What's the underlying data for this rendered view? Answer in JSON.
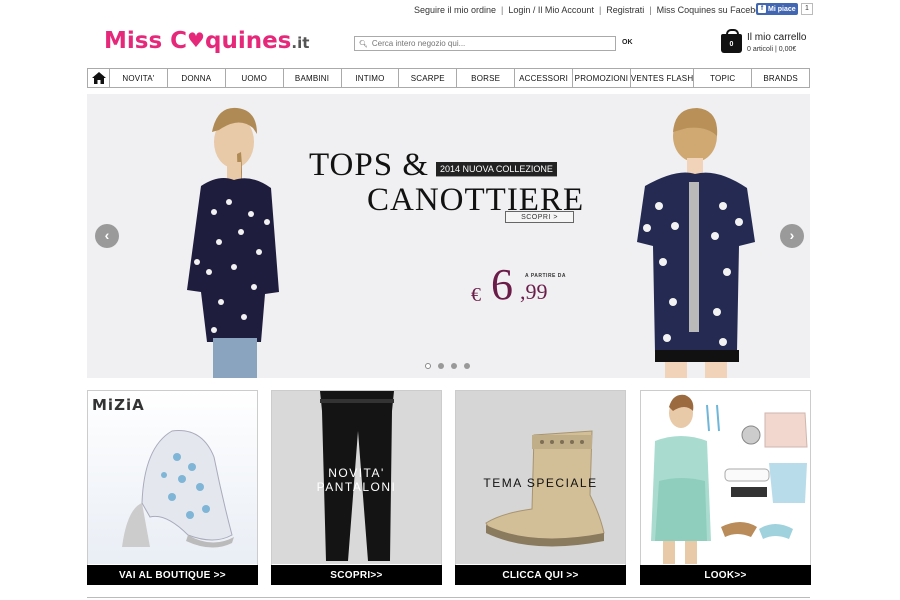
{
  "header": {
    "top_links": [
      "Seguire il mio ordine",
      "Login / Il Mio Account",
      "Registrati",
      "Miss Coquines su Facebook"
    ],
    "fb_like_label": "Mi piace",
    "fb_like_count": "1",
    "logo_text_1": "Miss C",
    "logo_text_2": "quines",
    "logo_suffix": ".it",
    "search_placeholder": "Cerca intero negozio qui...",
    "search_button": "OK",
    "cart_count": "0",
    "cart_title": "Il mio carrello",
    "cart_summary": "0 articoli | 0,00€"
  },
  "nav": {
    "items": [
      "NOVITA'",
      "DONNA",
      "UOMO",
      "BAMBINI",
      "INTIMO",
      "SCARPE",
      "BORSE",
      "ACCESSORI",
      "PROMOZIONI",
      "VENTES FLASH",
      "TOPIC",
      "BRANDS"
    ]
  },
  "hero": {
    "title_line1": "TOPS &",
    "title_line2": "CANOTTIERE",
    "badge": "2014 NUOVA COLLEZIONE",
    "cta": "SCOPRI >",
    "price_prefix": "A PARTIRE DA",
    "price_currency": "€",
    "price_whole": "6",
    "price_cents": ",99",
    "slides_total": 4,
    "active_slide": 1
  },
  "tiles": [
    {
      "brand": "MiZiA",
      "caption": "",
      "button": "VAI AL BOUTIQUE >>"
    },
    {
      "brand": "",
      "caption_line1": "NOVITA'",
      "caption_line2": "PANTALONI",
      "button": "SCOPRI>>"
    },
    {
      "brand": "",
      "caption_line1": "TEMA SPECIALE",
      "caption_line2": "",
      "button": "CLICCA QUI >>"
    },
    {
      "brand": "",
      "caption": "",
      "button": "LOOK>>"
    }
  ],
  "colors": {
    "brand_pink": "#e6287a",
    "price_purple": "#6b1d4a",
    "hero_bg": "#f0f0f2"
  }
}
